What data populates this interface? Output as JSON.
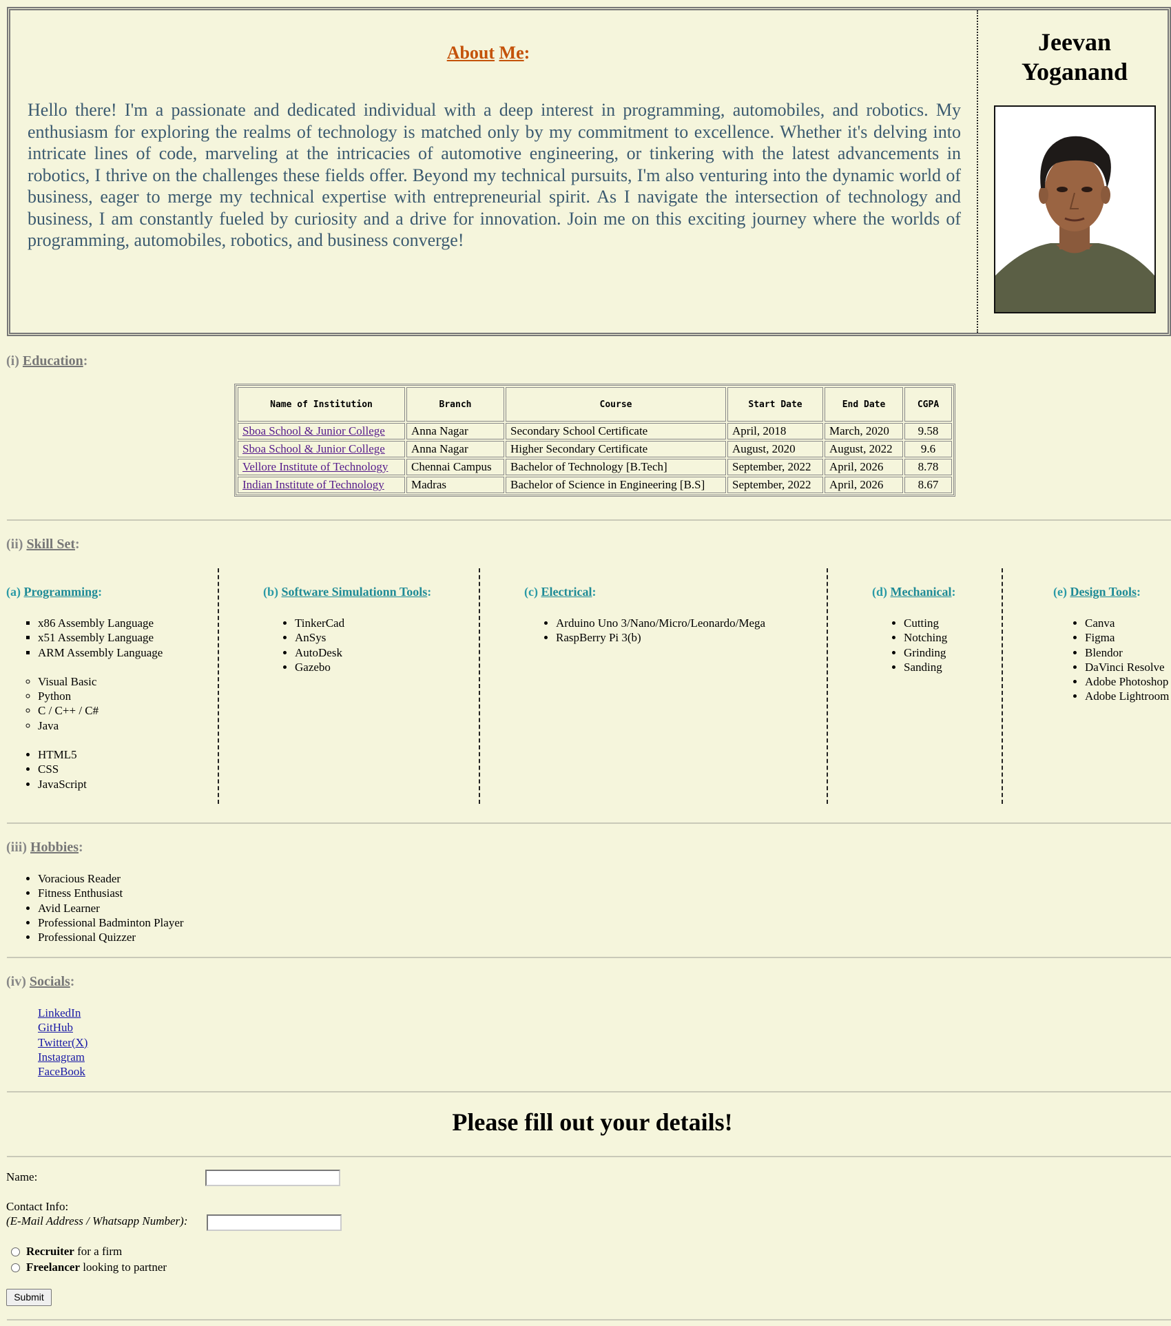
{
  "about": {
    "title_word1": "About",
    "title_word2": "Me",
    "text": "Hello there! I'm a passionate and dedicated individual with a deep interest in programming, automobiles, and robotics. My enthusiasm for exploring the realms of technology is matched only by my commitment to excellence. Whether it's delving into intricate lines of code, marveling at the intricacies of automotive engineering, or tinkering with the latest advancements in robotics, I thrive on the challenges these fields offer. Beyond my technical pursuits, I'm also venturing into the dynamic world of business, eager to merge my technical expertise with entrepreneurial spirit. As I navigate the intersection of technology and business, I am constantly fueled by curiosity and a drive for innovation. Join me on this exciting journey where the worlds of programming, automobiles, robotics, and business converge!"
  },
  "profile": {
    "first_name": "Jeevan",
    "last_name": "Yoganand"
  },
  "education": {
    "prefix": "(i)",
    "title": "Education",
    "headers": [
      "Name of Institution",
      "Branch",
      "Course",
      "Start Date",
      "End Date",
      "CGPA"
    ],
    "rows": [
      [
        "Sboa School & Junior College",
        "Anna Nagar",
        "Secondary School Certificate",
        "April, 2018",
        "March, 2020",
        "9.58"
      ],
      [
        "Sboa School & Junior College",
        "Anna Nagar",
        "Higher Secondary Certificate",
        "August, 2020",
        "August, 2022",
        "9.6"
      ],
      [
        "Vellore Institute of Technology",
        "Chennai Campus",
        "Bachelor of Technology [B.Tech]",
        "September, 2022",
        "April, 2026",
        "8.78"
      ],
      [
        "Indian Institute of Technology",
        "Madras",
        "Bachelor of Science in Engineering [B.S]",
        "September, 2022",
        "April, 2026",
        "8.67"
      ]
    ]
  },
  "skills": {
    "prefix": "(ii)",
    "title": "Skill Set",
    "programming": {
      "prefix": "(a)",
      "title": "Programming",
      "group1": [
        "x86 Assembly Language",
        "x51 Assembly Language",
        "ARM Assembly Language"
      ],
      "group2": [
        "Visual Basic",
        "Python",
        "C / C++ / C#",
        "Java"
      ],
      "group3": [
        "HTML5",
        "CSS",
        "JavaScript"
      ]
    },
    "software": {
      "prefix": "(b)",
      "title": "Software Simulationn Tools",
      "items": [
        "TinkerCad",
        "AnSys",
        "AutoDesk",
        "Gazebo"
      ]
    },
    "electrical": {
      "prefix": "(c)",
      "title": "Electrical",
      "items": [
        "Arduino Uno 3/Nano/Micro/Leonardo/Mega",
        "RaspBerry Pi 3(b)"
      ]
    },
    "mechanical": {
      "prefix": "(d)",
      "title": "Mechanical",
      "items": [
        "Cutting",
        "Notching",
        "Grinding",
        "Sanding"
      ]
    },
    "design": {
      "prefix": "(e)",
      "title": "Design Tools",
      "items": [
        "Canva",
        "Figma",
        "Blendor",
        "DaVinci Resolve",
        "Adobe Photoshop",
        "Adobe Lightroom"
      ]
    }
  },
  "hobbies": {
    "prefix": "(iii)",
    "title": "Hobbies",
    "items": [
      "Voracious Reader",
      "Fitness Enthusiast",
      "Avid Learner",
      "Professional Badminton Player",
      "Professional Quizzer"
    ]
  },
  "socials": {
    "prefix": "(iv)",
    "title": "Socials",
    "links": [
      "LinkedIn",
      "GitHub",
      "Twitter(X)",
      "Instagram",
      "FaceBook"
    ]
  },
  "form": {
    "title": "Please fill out your details!",
    "name_label": "Name:",
    "contact_label": "Contact Info:",
    "contact_hint": "(E-Mail Address / Whatsapp Number):",
    "radio1_bold": "Recruiter",
    "radio1_rest": " for a firm",
    "radio2_bold": "Freelancer",
    "radio2_rest": " looking to partner",
    "submit": "Submit"
  },
  "colors": {
    "background": "#f5f5dc",
    "about_heading": "#c4520a",
    "about_text": "#3b5a70",
    "skill_heading": "#2a9aa6",
    "section_heading": "#888888"
  }
}
